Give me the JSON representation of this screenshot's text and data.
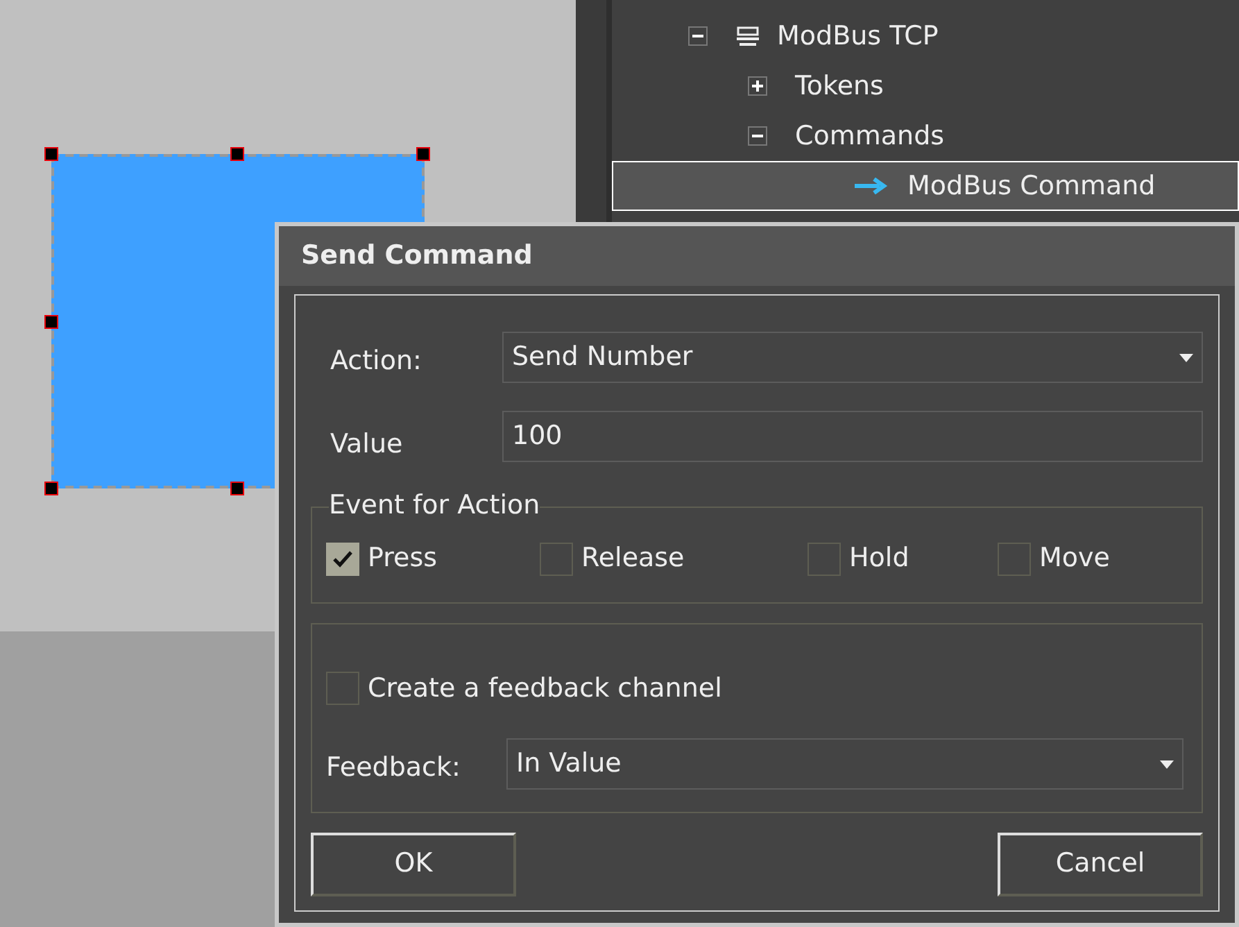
{
  "tree": [
    {
      "label": "ModBus TCP",
      "expanded": true,
      "selected": false,
      "kind": "device",
      "children": [
        {
          "label": "Tokens",
          "expanded": false,
          "selected": false,
          "kind": "folder"
        },
        {
          "label": "Commands",
          "expanded": true,
          "selected": false,
          "kind": "folder",
          "children": [
            {
              "label": "ModBus Command",
              "selected": true,
              "kind": "command"
            }
          ]
        }
      ]
    }
  ],
  "dialog": {
    "title": "Send Command",
    "action": {
      "label": "Action:",
      "value": "Send Number"
    },
    "value": {
      "label": "Value",
      "value": "100"
    },
    "events": {
      "legend": "Event for Action",
      "options": [
        {
          "label": "Press",
          "checked": true
        },
        {
          "label": "Release",
          "checked": false
        },
        {
          "label": "Hold",
          "checked": false
        },
        {
          "label": "Move",
          "checked": false
        }
      ]
    },
    "feedback_channel": {
      "label": "Create a feedback channel",
      "checked": false
    },
    "feedback": {
      "label": "Feedback:",
      "value": "In Value"
    },
    "buttons": [
      {
        "label": "OK"
      },
      {
        "label": "Cancel"
      }
    ]
  }
}
